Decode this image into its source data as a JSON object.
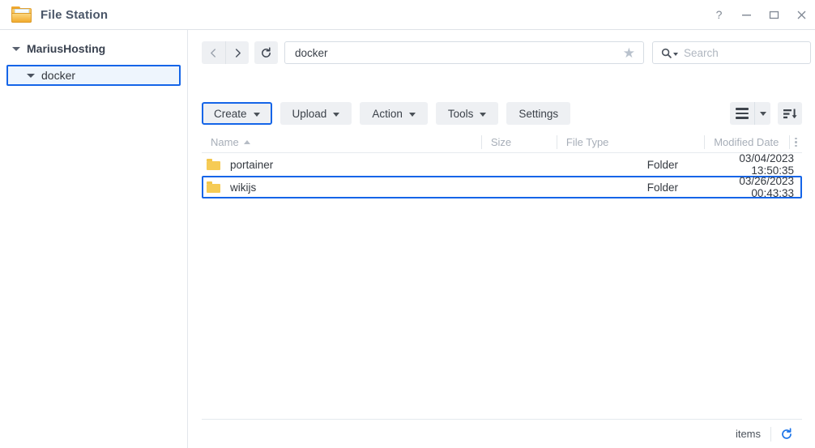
{
  "window": {
    "title": "File Station",
    "app_icon": "folder-icon",
    "controls": [
      {
        "name": "help-button",
        "label": "?"
      },
      {
        "name": "minimize-button",
        "label": "–"
      },
      {
        "name": "maximize-button",
        "label": "□"
      },
      {
        "name": "close-button",
        "label": "✕"
      }
    ]
  },
  "sidebar": {
    "root": {
      "label": "MariusHosting",
      "expanded": true
    },
    "children": [
      {
        "label": "docker",
        "expanded": true,
        "selected": true
      }
    ]
  },
  "navbar": {
    "back_icon": "chevron-left-icon",
    "forward_icon": "chevron-right-icon",
    "refresh_icon": "refresh-icon",
    "path_value": "docker",
    "favorite_icon": "star-icon",
    "search_placeholder": "Search",
    "search_value": "",
    "search_icon": "search-icon"
  },
  "toolbar": {
    "buttons": [
      {
        "label": "Create",
        "dropdown": true,
        "focused": true
      },
      {
        "label": "Upload",
        "dropdown": true,
        "focused": false
      },
      {
        "label": "Action",
        "dropdown": true,
        "focused": false
      },
      {
        "label": "Tools",
        "dropdown": true,
        "focused": false
      },
      {
        "label": "Settings",
        "dropdown": false,
        "focused": false
      }
    ],
    "view_icon": "list-view-icon",
    "view_dropdown_icon": "chevron-down-icon",
    "sort_icon": "sort-descending-icon"
  },
  "list": {
    "columns": [
      {
        "key": "name",
        "label": "Name",
        "sorted": "asc"
      },
      {
        "key": "size",
        "label": "Size"
      },
      {
        "key": "type",
        "label": "File Type"
      },
      {
        "key": "date",
        "label": "Modified Date"
      }
    ],
    "more_icon": "kebab-menu-icon",
    "rows": [
      {
        "icon": "folder-icon",
        "name": "portainer",
        "size": "",
        "type": "Folder",
        "date": "03/04/2023 13:50:35",
        "selected": false
      },
      {
        "icon": "folder-icon",
        "name": "wikijs",
        "size": "",
        "type": "Folder",
        "date": "03/26/2023 00:43:33",
        "selected": true
      }
    ]
  },
  "statusbar": {
    "items_label": "items",
    "refresh_icon": "refresh-icon"
  }
}
